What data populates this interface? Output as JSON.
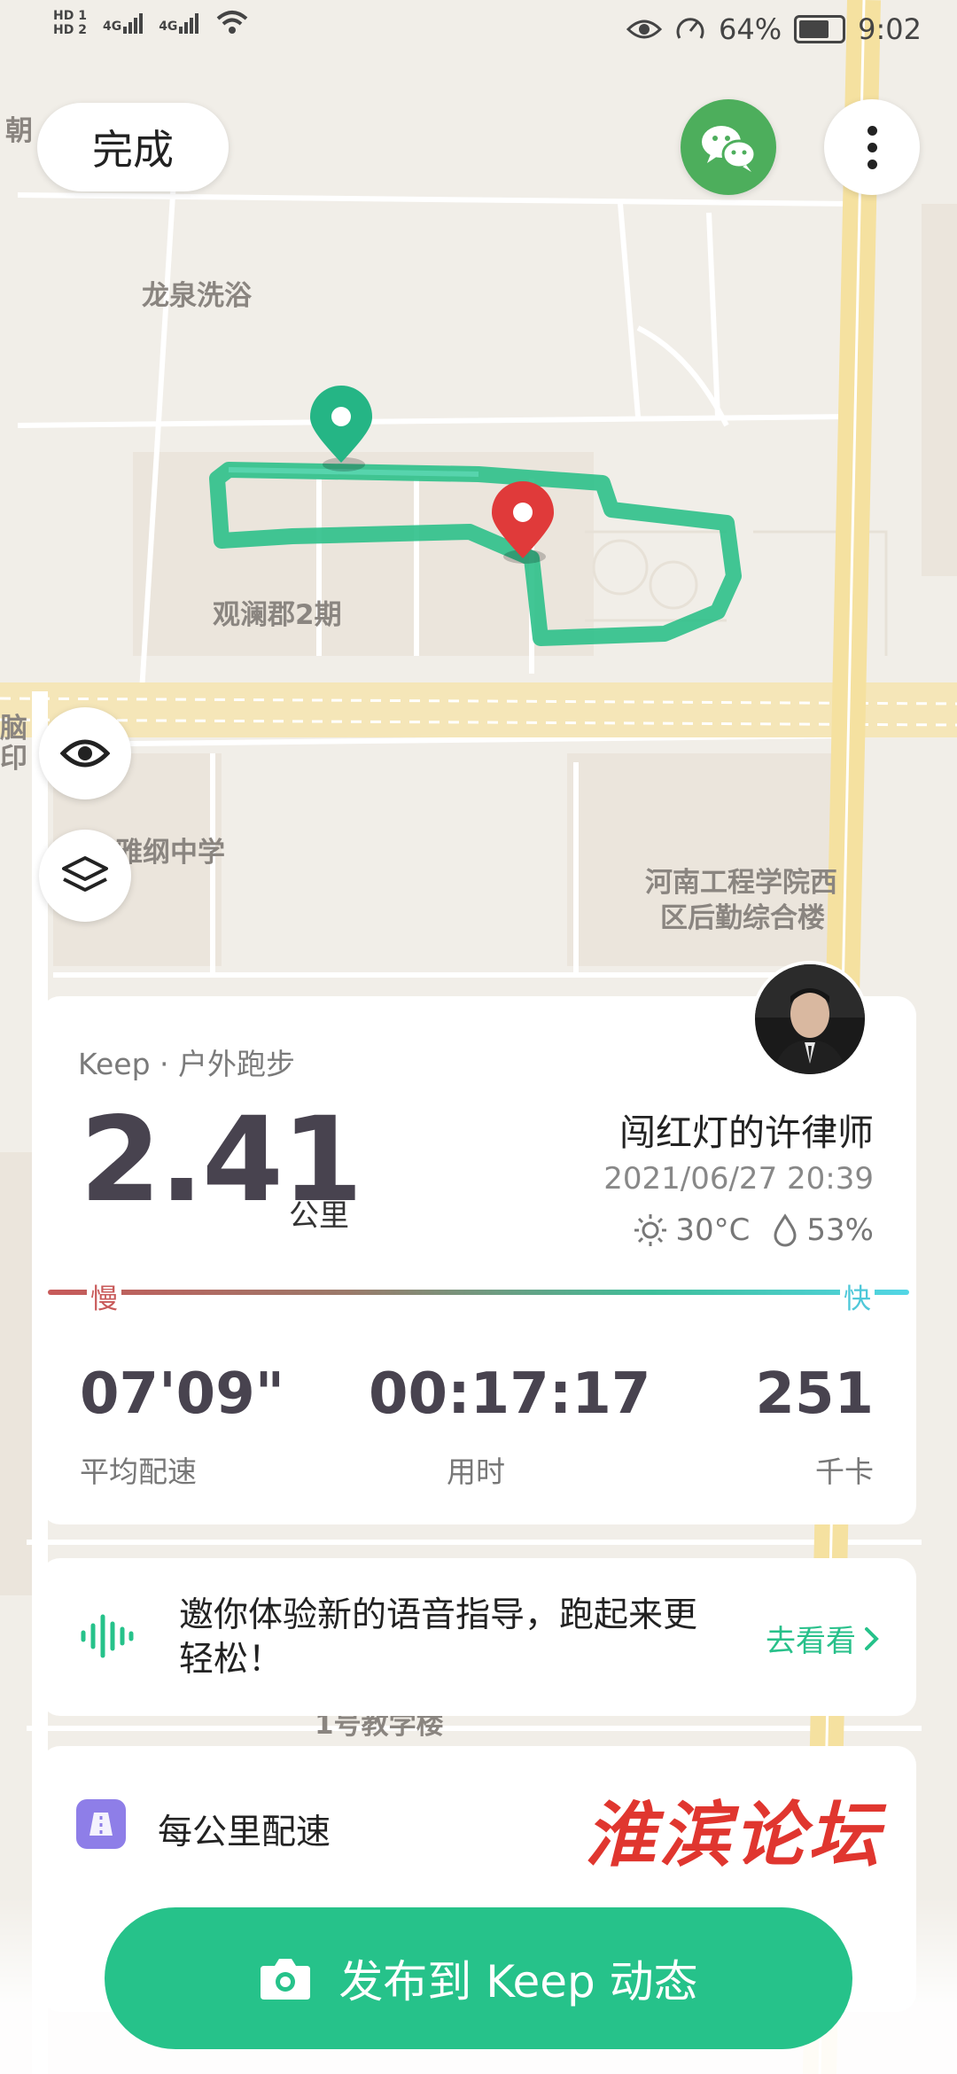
{
  "status_bar": {
    "hd1": "HD 1",
    "hd2": "HD 2",
    "signal1": "4G",
    "signal2": "4G",
    "battery": "64%",
    "time": "9:02"
  },
  "map": {
    "labels": {
      "chaoyang": "朝",
      "longquan": "龙泉洗浴",
      "guanlan": "观澜郡2期",
      "school": "雅纲中学",
      "henan1": "河南工程学院西",
      "henan2": "区后勤综合楼",
      "left_edge1": "脑",
      "left_edge2": "印",
      "building": "1号教学楼"
    }
  },
  "top_bar": {
    "done_label": "完成"
  },
  "stats": {
    "source": "Keep · 户外跑步",
    "distance": "2.41",
    "distance_unit": "公里",
    "user_name": "闯红灯的许律师",
    "datetime": "2021/06/27 20:39",
    "temperature": "30°C",
    "humidity": "53%",
    "slow_label": "慢",
    "fast_label": "快",
    "pace_value": "07'09\"",
    "pace_label": "平均配速",
    "time_value": "00:17:17",
    "time_label": "用时",
    "cal_value": "251",
    "cal_label": "千卡"
  },
  "voice_banner": {
    "text": "邀你体验新的语音指导，跑起来更轻松！",
    "link": "去看看"
  },
  "per_km": {
    "title": "每公里配速",
    "watermark": "淮滨论坛"
  },
  "publish_button": {
    "label": "发布到 Keep 动态"
  },
  "colors": {
    "accent": "#26c28a",
    "route": "#2ec08a",
    "end_pin": "#e03a3a",
    "wechat": "#4dae5c"
  }
}
